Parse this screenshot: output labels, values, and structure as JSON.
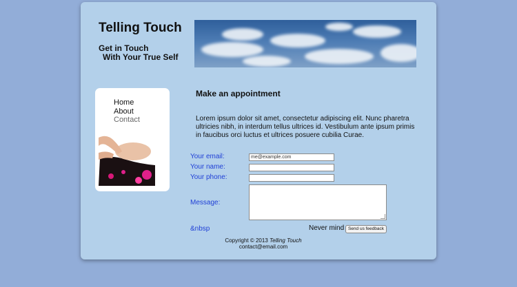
{
  "site": {
    "title": "Telling Touch",
    "tagline_line1": "Get in Touch",
    "tagline_line2": "With Your True Self"
  },
  "nav": {
    "items": [
      {
        "label": "Home"
      },
      {
        "label": "About"
      },
      {
        "label": "Contact",
        "active": true
      }
    ]
  },
  "main": {
    "heading": "Make an appointment",
    "intro": "Lorem ipsum dolor sit amet, consectetur adipiscing elit. Nunc pharetra ultricies nibh, in interdum tellus ultrices id. Vestibulum ante ipsum primis in faucibus orci luctus et ultrices posuere cubilia Curae."
  },
  "form": {
    "email_label": "Your email:",
    "email_value": "me@example.com",
    "name_label": "Your name:",
    "name_value": "",
    "phone_label": "Your phone:",
    "phone_value": "",
    "message_label": "Message:",
    "nbsp_text": "&nbsp",
    "never_mind": "Never mind",
    "send_label": "Send us feedback"
  },
  "footer": {
    "copyright_prefix": "Copyright © 2013",
    "copyright_name": "Telling Touch",
    "email": "contact@email.com"
  },
  "colors": {
    "page_bg": "#92add8",
    "panel_bg": "#b3d0ea",
    "label_blue": "#1f3fd6"
  }
}
